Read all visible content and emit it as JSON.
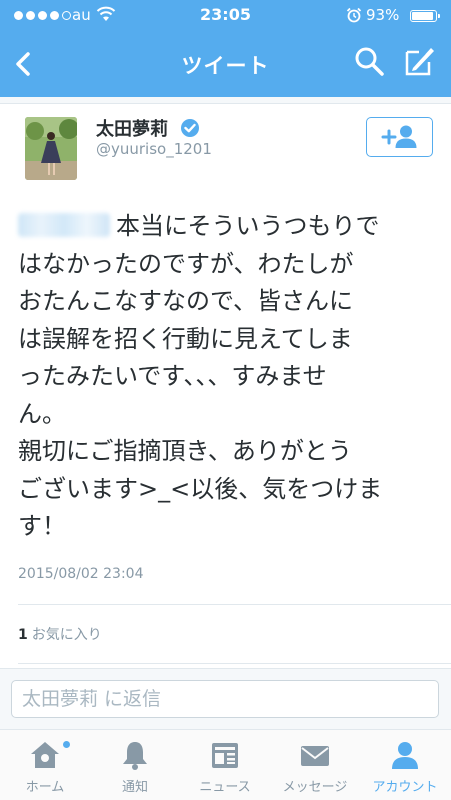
{
  "status": {
    "carrier": "au",
    "time": "23:05",
    "battery": "93%"
  },
  "nav": {
    "title": "ツイート"
  },
  "tweet": {
    "user_name": "太田夢莉",
    "user_handle": "@yuuriso_1201",
    "lines": [
      "本当にそういうつもりで",
      "はなかったのですが、わたしが",
      "おたんこなすなので、皆さんに",
      "は誤解を招く行動に見えてしま",
      "ったみたいです、、、すみませ",
      "ん。",
      "親切にご指摘頂き、ありがとう",
      "ございます>_<以後、気をつけま",
      "す！"
    ],
    "timestamp": "2015/08/02 23:04",
    "favorite_count": "1",
    "favorite_label": "お気に入り"
  },
  "reply": {
    "placeholder": "太田夢莉 に返信"
  },
  "tabs": [
    {
      "label": "ホーム",
      "icon": "home-icon"
    },
    {
      "label": "通知",
      "icon": "bell-icon"
    },
    {
      "label": "ニュース",
      "icon": "news-icon"
    },
    {
      "label": "メッセージ",
      "icon": "envelope-icon"
    },
    {
      "label": "アカウント",
      "icon": "person-icon"
    }
  ],
  "colors": {
    "accent": "#55acee",
    "text": "#292f33",
    "muted": "#8899a6"
  }
}
